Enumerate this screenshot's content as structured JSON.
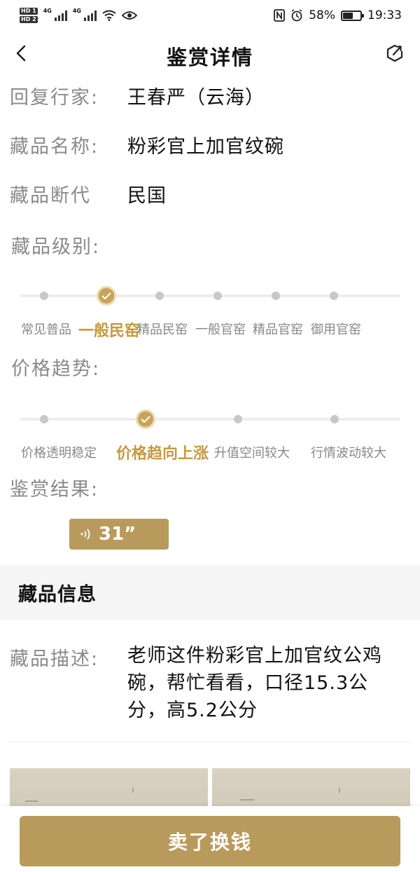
{
  "status_bar": {
    "hd1": "HD 1",
    "hd2": "HD 2",
    "net1": "4G",
    "net2": "4G",
    "battery_percent": "58%",
    "battery_level": 0.58,
    "time": "19:33"
  },
  "header": {
    "title": "鉴赏详情"
  },
  "info": {
    "expert_label": "回复行家:",
    "expert_value": "王春严（云海）",
    "name_label": "藏品名称:",
    "name_value": "粉彩官上加官纹碗",
    "era_label": "藏品断代",
    "era_value": "民国"
  },
  "level": {
    "label": "藏品级别:",
    "options": [
      "常见普品",
      "一般民窑",
      "精品民窑",
      "一般官窑",
      "精品官窑",
      "御用官窑"
    ],
    "selected_index": 1
  },
  "trend": {
    "label": "价格趋势:",
    "options": [
      "价格透明稳定",
      "价格趋向上涨",
      "升值空间较大",
      "行情波动较大"
    ],
    "selected_index": 1
  },
  "result": {
    "label": "鉴赏结果:",
    "audio_duration": "31”"
  },
  "collection_info": {
    "title": "藏品信息",
    "desc_label": "藏品描述:",
    "description": "老师这件粉彩官上加官纹公鸡碗，帮忙看看，口径15.3公分，高5.2公分"
  },
  "bottom": {
    "sell_label": "卖了换钱"
  },
  "colors": {
    "accent": "#b89a5c",
    "active_text": "#c79a42"
  }
}
